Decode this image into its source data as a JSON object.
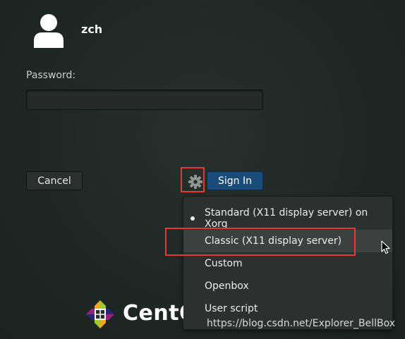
{
  "user": {
    "name": "zch"
  },
  "login": {
    "password_label": "Password:",
    "password_value": "",
    "cancel_label": "Cancel",
    "signin_label": "Sign In"
  },
  "session_menu": {
    "items": [
      {
        "label": "Standard (X11 display server) on Xorg",
        "selected": true
      },
      {
        "label": "Classic (X11 display server)",
        "hovered": true
      },
      {
        "label": "Custom"
      },
      {
        "label": "Openbox"
      },
      {
        "label": "User script"
      }
    ]
  },
  "branding": {
    "logo_text": "CentOS"
  },
  "watermark": "https://blog.csdn.net/Explorer_BellBox",
  "colors": {
    "background": "#1f2725",
    "signin_button": "#1b4b78",
    "highlight_box": "#e53935",
    "menu_background": "#2c302f",
    "menu_hover": "#3c4140"
  },
  "icons": {
    "avatar": "user-avatar-icon",
    "session": "gear-icon",
    "cursor": "mouse-pointer-icon",
    "logo": "centos-logo-icon"
  }
}
